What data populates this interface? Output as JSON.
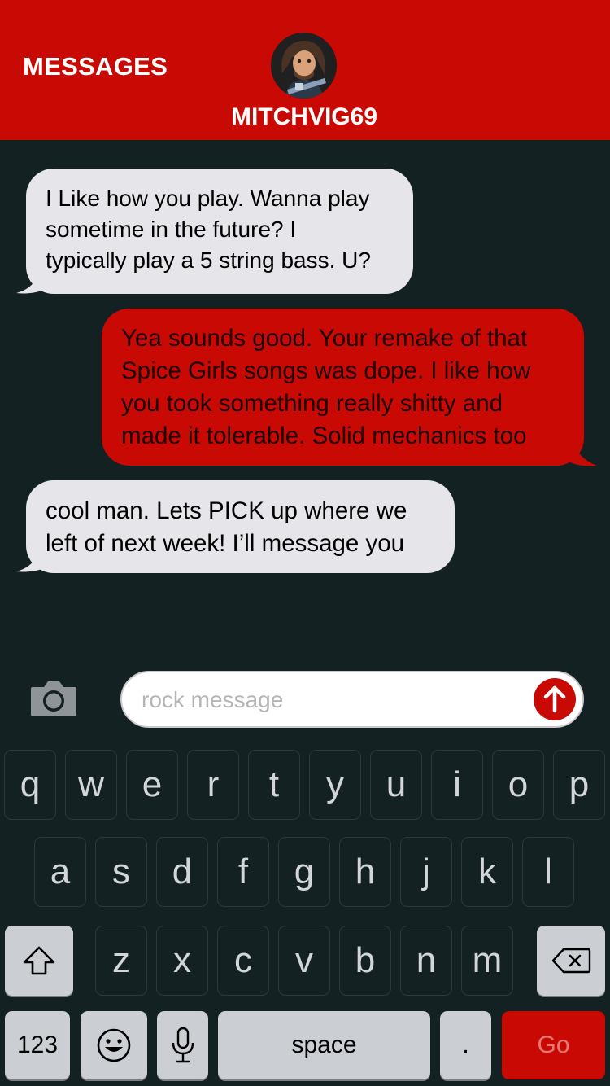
{
  "header": {
    "title": "MESSAGES",
    "contact_name": "MITCHVIG69",
    "avatar_icon": "user-avatar"
  },
  "messages": [
    {
      "direction": "incoming",
      "lines": [
        "I Like how you play.  Wanna play",
        "sometime in the future?  I",
        "typically play a 5 string bass.  U?"
      ]
    },
    {
      "direction": "outgoing",
      "lines": [
        "Yea sounds good.  Your remake of that",
        "Spice Girls songs was dope.  I like how",
        "you took something really shitty and",
        "made it tolerable.  Solid mechanics too"
      ]
    },
    {
      "direction": "incoming",
      "lines": [
        "cool man. Lets PICK up where we",
        "left of next week!  I’ll message you"
      ]
    }
  ],
  "composer": {
    "placeholder": "rock message",
    "camera_icon": "camera-icon",
    "send_icon": "arrow-up-icon"
  },
  "keyboard": {
    "row1": [
      "q",
      "w",
      "e",
      "r",
      "t",
      "y",
      "u",
      "i",
      "o",
      "p"
    ],
    "row2": [
      "a",
      "s",
      "d",
      "f",
      "g",
      "h",
      "j",
      "k",
      "l"
    ],
    "row3": [
      "z",
      "x",
      "c",
      "v",
      "b",
      "n",
      "m"
    ],
    "numbers_label": "123",
    "space_label": "space",
    "period_label": ".",
    "go_label": "Go"
  },
  "colors": {
    "accent": "#c90a04",
    "background": "#142122",
    "incoming_bubble": "#e5e5ea"
  }
}
